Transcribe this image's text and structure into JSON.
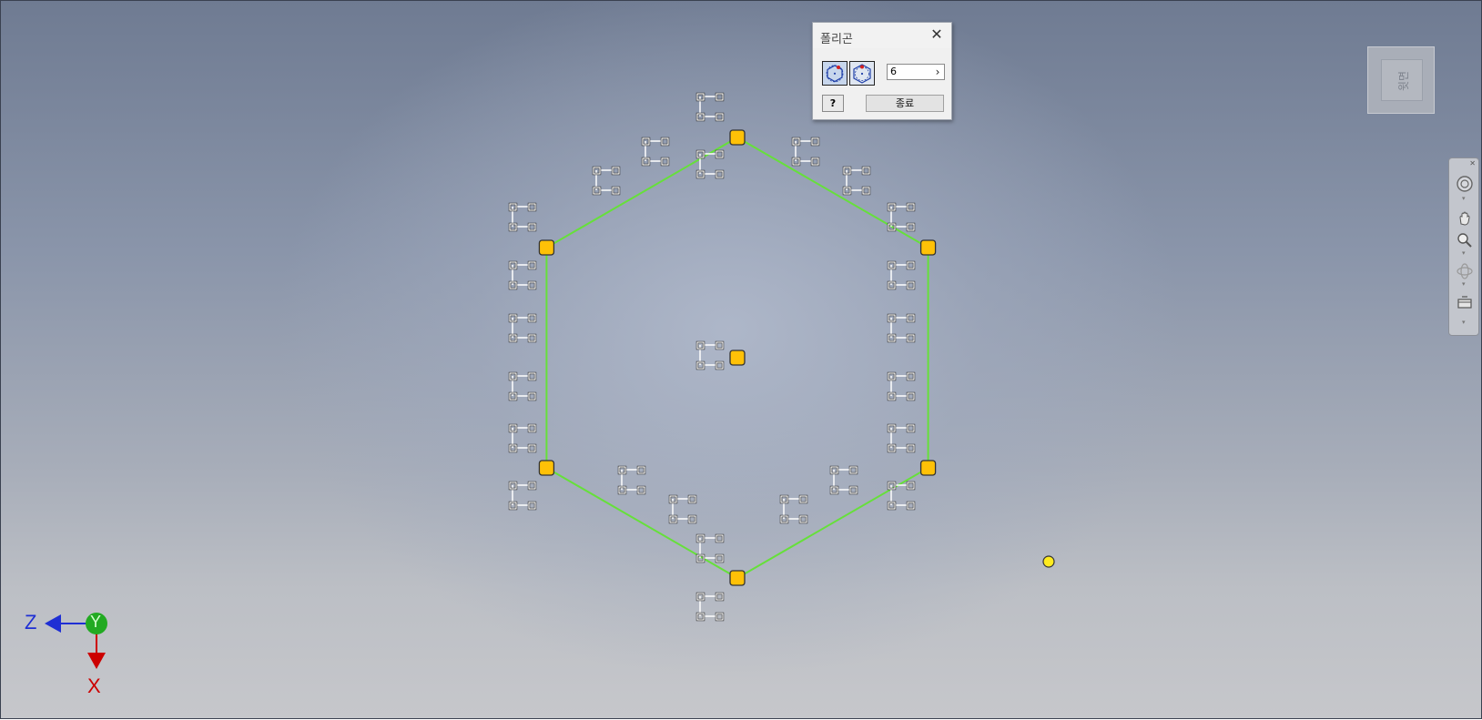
{
  "dialog": {
    "title": "폴리곤",
    "close_label": "✕",
    "sides_value": "6",
    "sides_arrow": "›",
    "help_label": "?",
    "finish_label": "종료",
    "modes": [
      {
        "name": "inscribed",
        "icon": "inscribed-polygon-icon",
        "active": true
      },
      {
        "name": "circumscribed",
        "icon": "circumscribed-polygon-icon",
        "active": false
      }
    ]
  },
  "viewcube": {
    "face_label": "윗면"
  },
  "navbar": {
    "items": [
      {
        "icon": "steering-wheel-icon"
      },
      {
        "icon": "pan-hand-icon"
      },
      {
        "icon": "zoom-icon"
      },
      {
        "icon": "orbit-icon"
      },
      {
        "icon": "view-face-icon"
      }
    ]
  },
  "axes": {
    "z_label": "Z",
    "y_label": "Y",
    "x_label": "X"
  },
  "sketch": {
    "polygon_sides": 6,
    "line_color": "#66e03a",
    "point_color": "#ffc107",
    "constraint_color": "#ffffff"
  },
  "colors": {
    "x_axis": "#cc0000",
    "y_axis": "#22aa22",
    "z_axis": "#1f2fd4",
    "cursor_point": "#ffeb1f"
  }
}
